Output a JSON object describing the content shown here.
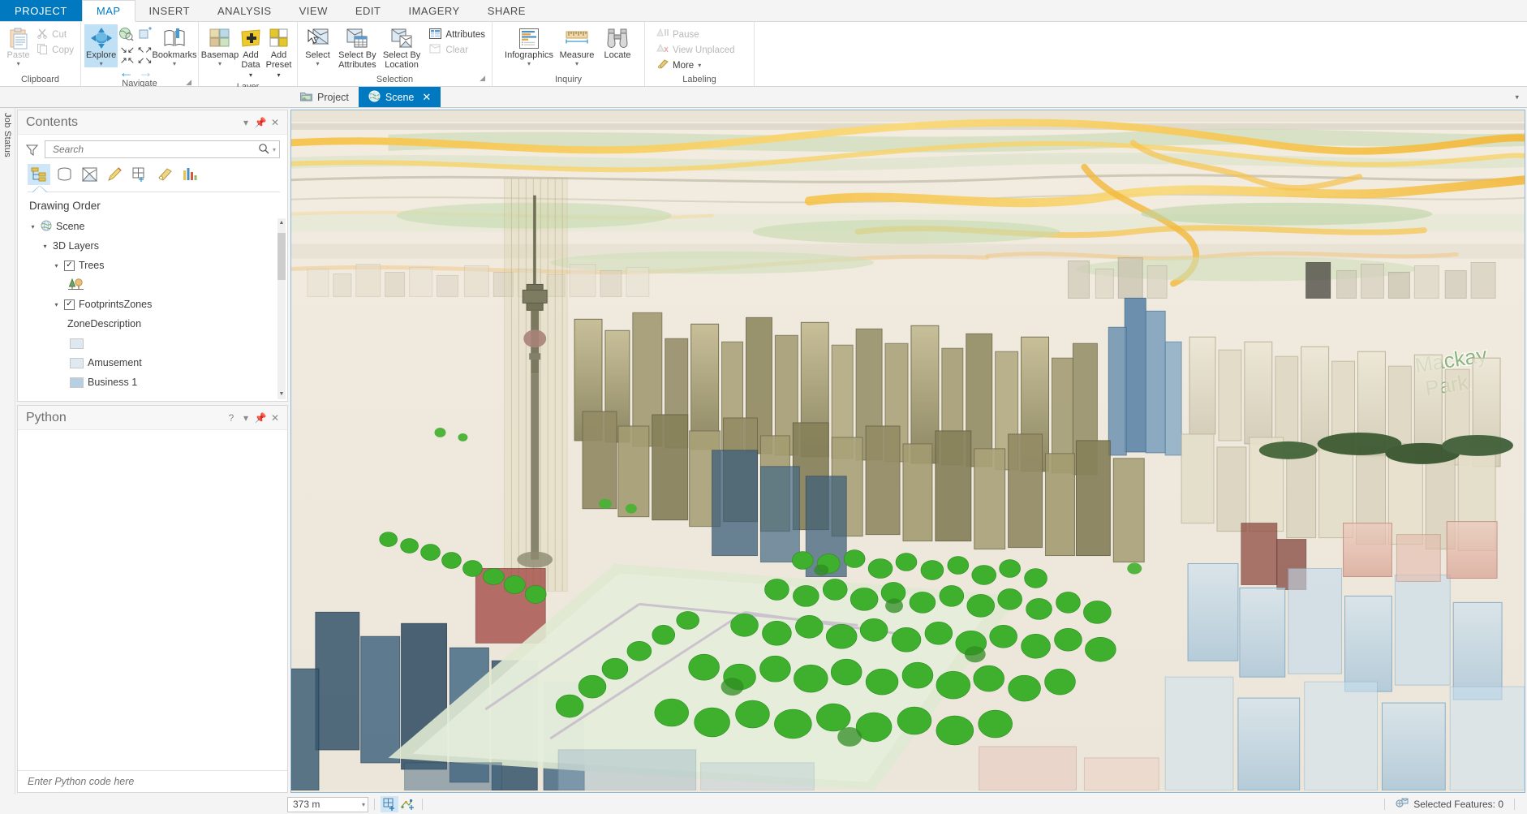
{
  "app": {
    "project_tab": "PROJECT",
    "ribbon_tabs": [
      "MAP",
      "INSERT",
      "ANALYSIS",
      "VIEW",
      "EDIT",
      "IMAGERY",
      "SHARE"
    ],
    "active_ribbon_tab": "MAP",
    "accent_color": "#0079c1",
    "selection_color": "#cfe6f7"
  },
  "ribbon": {
    "groups": [
      {
        "label": "Clipboard",
        "has_dialog_launcher": false,
        "big_buttons": [
          {
            "label": "Paste",
            "icon": "paste-icon",
            "has_caret": true,
            "disabled": true
          }
        ],
        "small_buttons": [
          {
            "label": "Cut",
            "icon": "cut-icon",
            "disabled": true
          },
          {
            "label": "Copy",
            "icon": "copy-icon",
            "disabled": true
          }
        ]
      },
      {
        "label": "Navigate",
        "has_dialog_launcher": true,
        "big_buttons": [
          {
            "label": "Explore",
            "icon": "explore-navigator-icon",
            "has_caret": true,
            "selected": true
          },
          {
            "label": "",
            "icon": "full-extent-icon",
            "has_caret": false
          },
          {
            "label": "Bookmarks",
            "icon": "bookmarks-icon",
            "has_caret": true
          }
        ]
      },
      {
        "label": "Layer",
        "has_dialog_launcher": false,
        "big_buttons": [
          {
            "label": "Basemap",
            "icon": "basemap-icon",
            "has_caret": true
          },
          {
            "label": "Add Data",
            "icon": "add-data-icon",
            "has_caret": true
          },
          {
            "label": "Add Preset",
            "icon": "add-preset-icon",
            "has_caret": true
          }
        ]
      },
      {
        "label": "Selection",
        "has_dialog_launcher": true,
        "big_buttons": [
          {
            "label": "Select",
            "icon": "select-icon",
            "has_caret": true
          },
          {
            "label": "Select By Attributes",
            "icon": "select-by-attributes-icon",
            "has_caret": false
          },
          {
            "label": "Select By Location",
            "icon": "select-by-location-icon",
            "has_caret": false
          }
        ],
        "small_buttons": [
          {
            "label": "Attributes",
            "icon": "attributes-icon",
            "disabled": false
          },
          {
            "label": "Clear",
            "icon": "clear-selection-icon",
            "disabled": true
          }
        ]
      },
      {
        "label": "Inquiry",
        "has_dialog_launcher": false,
        "big_buttons": [
          {
            "label": "Infographics",
            "icon": "infographics-icon",
            "has_caret": true
          },
          {
            "label": "Measure",
            "icon": "measure-icon",
            "has_caret": true
          },
          {
            "label": "Locate",
            "icon": "locate-binoculars-icon",
            "has_caret": false
          }
        ]
      },
      {
        "label": "Labeling",
        "has_dialog_launcher": false,
        "small_buttons": [
          {
            "label": "Pause",
            "icon": "pause-labeling-icon",
            "disabled": true
          },
          {
            "label": "View Unplaced",
            "icon": "view-unplaced-icon",
            "disabled": true
          },
          {
            "label": "More",
            "icon": "more-labeling-icon",
            "disabled": false,
            "has_caret": true
          }
        ]
      }
    ]
  },
  "view_tabs": {
    "items": [
      {
        "label": "Project",
        "icon": "project-icon",
        "active": false,
        "closable": false
      },
      {
        "label": "Scene",
        "icon": "globe-icon",
        "active": true,
        "closable": true
      }
    ],
    "close_glyph": "✕",
    "overflow_caret": "▾"
  },
  "job_status": {
    "label": "Job Status"
  },
  "contents_pane": {
    "title": "Contents",
    "header_buttons": [
      "menu-caret",
      "auto-hide-pin",
      "close"
    ],
    "search": {
      "placeholder": "Search",
      "value": "",
      "icon": "search-icon"
    },
    "filter_icon": "filter-funnel-icon",
    "toolbar_icons": [
      "list-by-drawing-order-icon",
      "list-by-data-source-icon",
      "list-by-selection-icon",
      "list-by-editing-icon",
      "list-by-snapping-icon",
      "list-by-labeling-icon",
      "list-by-charts-icon"
    ],
    "section_title": "Drawing Order",
    "tree": [
      {
        "indent": 0,
        "twisty": "▾",
        "icon": "globe-icon",
        "label": "Scene",
        "checkbox": null
      },
      {
        "indent": 1,
        "twisty": "▾",
        "icon": null,
        "label": "3D Layers",
        "checkbox": null
      },
      {
        "indent": 2,
        "twisty": "▾",
        "icon": null,
        "label": "Trees",
        "checkbox": true
      },
      {
        "indent": 3,
        "twisty": null,
        "icon": "tree-symbol-icon",
        "label": "",
        "checkbox": null
      },
      {
        "indent": 2,
        "twisty": "▾",
        "icon": null,
        "label": "FootprintsZones",
        "checkbox": true
      },
      {
        "indent": 3,
        "twisty": null,
        "icon": null,
        "label": "ZoneDescription",
        "checkbox": null
      },
      {
        "indent": 3,
        "twisty": null,
        "swatch": "#dde8f1",
        "label": "",
        "checkbox": null
      },
      {
        "indent": 3,
        "twisty": null,
        "swatch": "#dfe9f2",
        "label": "Amusement",
        "checkbox": null
      },
      {
        "indent": 3,
        "twisty": null,
        "swatch": "#b7cfe3",
        "label": "Business 1",
        "checkbox": null
      }
    ]
  },
  "python_pane": {
    "title": "Python",
    "header_buttons": [
      "help",
      "menu-caret",
      "auto-hide-pin",
      "close"
    ],
    "input_placeholder": "Enter Python code here",
    "input_value": "",
    "output": ""
  },
  "map": {
    "scale": "373 m",
    "scale_caret": "▾",
    "tools": [
      "add-preset-tool-icon",
      "explore-3d-tool-icon"
    ],
    "labels": [
      "Mackay Park"
    ],
    "selected_features_label": "Selected Features: 0",
    "selected_features_icon": "selected-features-icon"
  }
}
